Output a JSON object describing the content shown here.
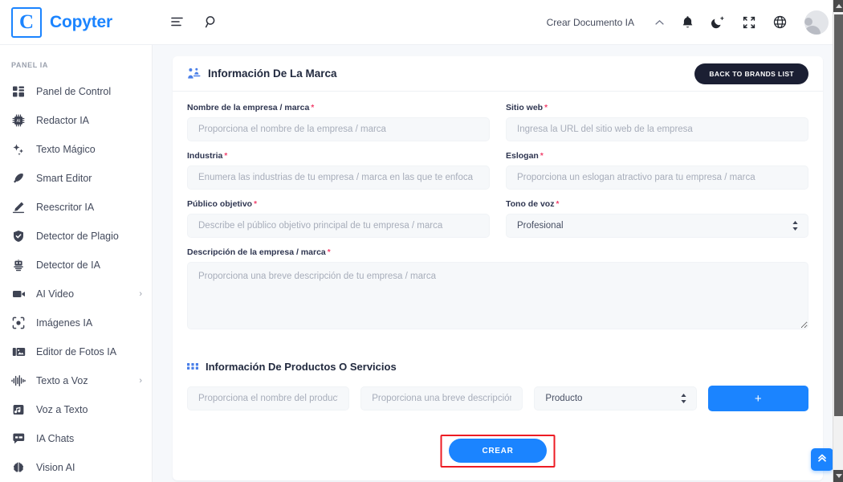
{
  "brand": {
    "logo_letter": "C",
    "name": "Copyter"
  },
  "header": {
    "menu_icon": "menu-lines-icon",
    "search_icon": "search-icon",
    "dropdown_label": "Crear Documento IA",
    "chevron_icon": "chevron-up-icon",
    "notification_icon": "bell-icon",
    "theme_icon": "moon-icon",
    "fullscreen_icon": "fullscreen-icon",
    "language_icon": "globe-icon",
    "avatar": "user-avatar"
  },
  "sidebar": {
    "section_title": "PANEL IA",
    "items": [
      {
        "label": "Panel de Control",
        "icon": "dashboard-icon",
        "has_submenu": false
      },
      {
        "label": "Redactor IA",
        "icon": "chip-ai-icon",
        "has_submenu": false
      },
      {
        "label": "Texto Mágico",
        "icon": "sparkles-icon",
        "has_submenu": false
      },
      {
        "label": "Smart Editor",
        "icon": "pen-icon",
        "has_submenu": false
      },
      {
        "label": "Reescritor IA",
        "icon": "pencil-icon",
        "has_submenu": false
      },
      {
        "label": "Detector de Plagio",
        "icon": "shield-check-icon",
        "has_submenu": false
      },
      {
        "label": "Detector de IA",
        "icon": "robot-icon",
        "has_submenu": false
      },
      {
        "label": "AI Video",
        "icon": "video-camera-icon",
        "has_submenu": true
      },
      {
        "label": "Imágenes IA",
        "icon": "camera-frame-icon",
        "has_submenu": false
      },
      {
        "label": "Editor de Fotos IA",
        "icon": "photo-edit-icon",
        "has_submenu": false
      },
      {
        "label": "Texto a Voz",
        "icon": "waveform-icon",
        "has_submenu": true
      },
      {
        "label": "Voz a Texto",
        "icon": "music-note-icon",
        "has_submenu": false
      },
      {
        "label": "IA Chats",
        "icon": "chat-bubble-icon",
        "has_submenu": false
      },
      {
        "label": "Vision AI",
        "icon": "brain-icon",
        "has_submenu": false
      }
    ]
  },
  "brand_card": {
    "icon": "brand-person-icon",
    "title": "Información De La Marca",
    "back_button": "BACK TO BRANDS LIST",
    "fields": {
      "company_name": {
        "label": "Nombre de la empresa / marca",
        "required": true,
        "placeholder": "Proporciona el nombre de la empresa / marca",
        "value": ""
      },
      "website": {
        "label": "Sitio web",
        "required": true,
        "placeholder": "Ingresa la URL del sitio web de la empresa",
        "value": ""
      },
      "industry": {
        "label": "Industria",
        "required": true,
        "placeholder": "Enumera las industrias de tu empresa / marca en las que te enfoca",
        "value": ""
      },
      "slogan": {
        "label": "Eslogan",
        "required": true,
        "placeholder": "Proporciona un eslogan atractivo para tu empresa / marca",
        "value": ""
      },
      "target_audience": {
        "label": "Público objetivo",
        "required": true,
        "placeholder": "Describe el público objetivo principal de tu empresa / marca",
        "value": ""
      },
      "tone_of_voice": {
        "label": "Tono de voz",
        "required": true,
        "selected": "Profesional",
        "options": [
          "Profesional"
        ]
      },
      "description": {
        "label": "Descripción de la empresa / marca",
        "required": true,
        "placeholder": "Proporciona una breve descripción de tu empresa / marca",
        "value": ""
      }
    }
  },
  "products_card": {
    "icon": "grid-dots-icon",
    "title": "Información De Productos O Servicios",
    "row": {
      "name_placeholder": "Proporciona el nombre del producto",
      "description_placeholder": "Proporciona una breve descripción",
      "type_selected": "Producto",
      "type_options": [
        "Producto"
      ],
      "add_button": "+"
    }
  },
  "submit": {
    "label": "CREAR",
    "highlighted": true
  },
  "fab": {
    "icon": "double-chevron-up-icon"
  },
  "colors": {
    "accent": "#1b84ff",
    "dark_button": "#1b1f33",
    "required_star": "#f1416c",
    "page_bg": "#f6f8fb",
    "highlight": "#ed1c24"
  }
}
